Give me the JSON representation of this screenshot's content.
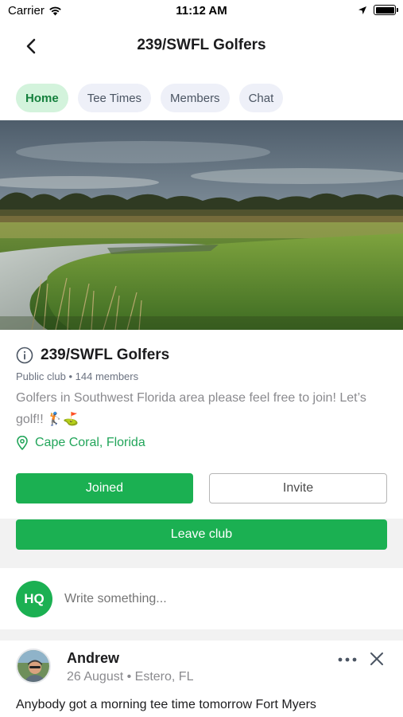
{
  "status_bar": {
    "carrier": "Carrier",
    "time": "11:12 AM",
    "icons": [
      "wifi-icon",
      "location-arrow-icon",
      "battery-icon"
    ]
  },
  "nav": {
    "title": "239/SWFL Golfers",
    "back_icon": "chevron-left-icon"
  },
  "tabs": [
    {
      "label": "Home",
      "active": true
    },
    {
      "label": "Tee Times",
      "active": false
    },
    {
      "label": "Members",
      "active": false
    },
    {
      "label": "Chat",
      "active": false
    }
  ],
  "club": {
    "info_icon": "info-circle-icon",
    "name": "239/SWFL Golfers",
    "meta": "Public club • 144 members",
    "description": "Golfers in Southwest Florida area please feel free to join! Let’s golf!! 🏌️⛳",
    "location_icon": "map-pin-icon",
    "location": "Cape Coral, Florida"
  },
  "actions": {
    "joined_label": "Joined",
    "invite_label": "Invite",
    "leave_label": "Leave club"
  },
  "composer": {
    "avatar_initials": "HQ",
    "placeholder": "Write something..."
  },
  "post": {
    "author": "Andrew",
    "meta": "26 August • Estero, FL",
    "body": "Anybody got a morning tee time tomorrow Fort Myers",
    "more_icon": "more-horizontal-icon",
    "close_icon": "close-icon"
  },
  "colors": {
    "brand_green": "#1bb052",
    "active_tab_bg": "#d3f3dc",
    "tab_bg": "#eef0f8",
    "location_green": "#22a55a"
  }
}
